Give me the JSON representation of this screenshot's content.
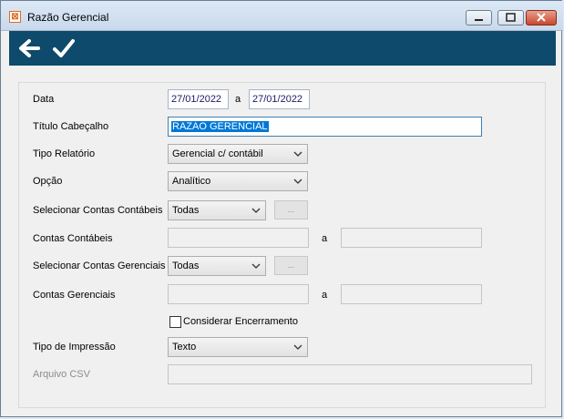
{
  "window": {
    "title": "Razão Gerencial",
    "app_icon": "report-icon"
  },
  "toolbar": {
    "back_icon": "back-arrow-icon",
    "confirm_icon": "checkmark-icon"
  },
  "form": {
    "data": {
      "label": "Data",
      "from": "27/01/2022",
      "sep": "a",
      "to": "27/01/2022"
    },
    "titulo": {
      "label": "Título Cabeçalho",
      "value": "RAZAO GERENCIAL"
    },
    "tipo_relatorio": {
      "label": "Tipo Relatório",
      "value": "Gerencial c/ contábil"
    },
    "opcao": {
      "label": "Opção",
      "value": "Analítico"
    },
    "sel_contas_contabeis": {
      "label": "Selecionar Contas Contábeis",
      "value": "Todas",
      "button": "..."
    },
    "contas_contabeis": {
      "label": "Contas Contábeis",
      "from": "",
      "sep": "a",
      "to": ""
    },
    "sel_contas_gerenciais": {
      "label": "Selecionar Contas Gerenciais",
      "value": "Todas",
      "button": "..."
    },
    "contas_gerenciais": {
      "label": "Contas Gerenciais",
      "from": "",
      "sep": "a",
      "to": ""
    },
    "encerramento": {
      "label": "Considerar Encerramento",
      "checked": false
    },
    "tipo_impressao": {
      "label": "Tipo de Impressão",
      "value": "Texto"
    },
    "arquivo_csv": {
      "label": "Arquivo CSV",
      "value": ""
    }
  },
  "colors": {
    "toolbar": "#0e4a6b",
    "selection": "#0078d7"
  }
}
